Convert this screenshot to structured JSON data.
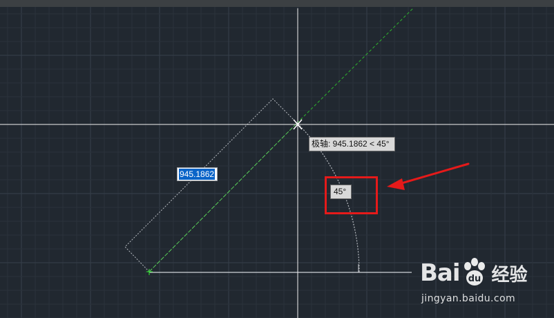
{
  "dimension_input": {
    "value": "945.1862"
  },
  "polar_tooltip": {
    "text": "极轴: 945.1862 < 45°"
  },
  "angle_label": {
    "text": "45°"
  },
  "watermark": {
    "logo_left": "Bai",
    "logo_right": "经验",
    "url": "jingyan.baidu.com"
  },
  "icons": [
    "crosshair-cursor-icon",
    "start-point-marker-icon",
    "annotation-arrow-icon",
    "baidu-paw-icon"
  ],
  "colors": {
    "background": "#212830",
    "grid_minor": "#2a323b",
    "grid_major": "#36404b",
    "crosshair": "#f2f2f2",
    "polar_tracking": "#2fb62f",
    "highlight": "#e51a1a",
    "selection": "#0a64c8"
  }
}
